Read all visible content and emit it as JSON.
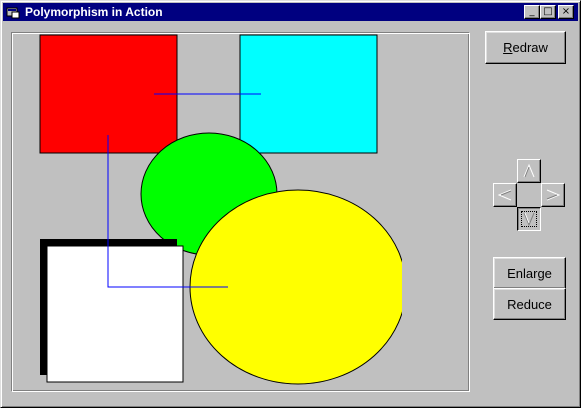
{
  "window": {
    "title": "Polymorphism in Action",
    "minimize_glyph": "_",
    "maximize_glyph": "□",
    "close_glyph": "×"
  },
  "buttons": {
    "redraw_label_underlined": "R",
    "redraw_label_rest": "edraw",
    "enlarge_label": "Enlarge",
    "reduce_label": "Reduce"
  },
  "nudge_pad": {
    "up_icon": "arrow-up-icon",
    "down_icon": "arrow-down-icon",
    "left_icon": "arrow-left-icon",
    "right_icon": "arrow-right-icon",
    "active": "down"
  },
  "shapes": [
    {
      "kind": "rectangle",
      "fill": "#ff0000"
    },
    {
      "kind": "rectangle",
      "fill": "#00ffff"
    },
    {
      "kind": "ellipse",
      "fill": "#00ff00"
    },
    {
      "kind": "rectangle",
      "fill": "#ffffff",
      "shadow": "#000000"
    },
    {
      "kind": "ellipse",
      "fill": "#ffff00"
    }
  ],
  "colors": {
    "title_bar": "#000080",
    "face": "#c0c0c0",
    "connector": "#0000ff"
  }
}
